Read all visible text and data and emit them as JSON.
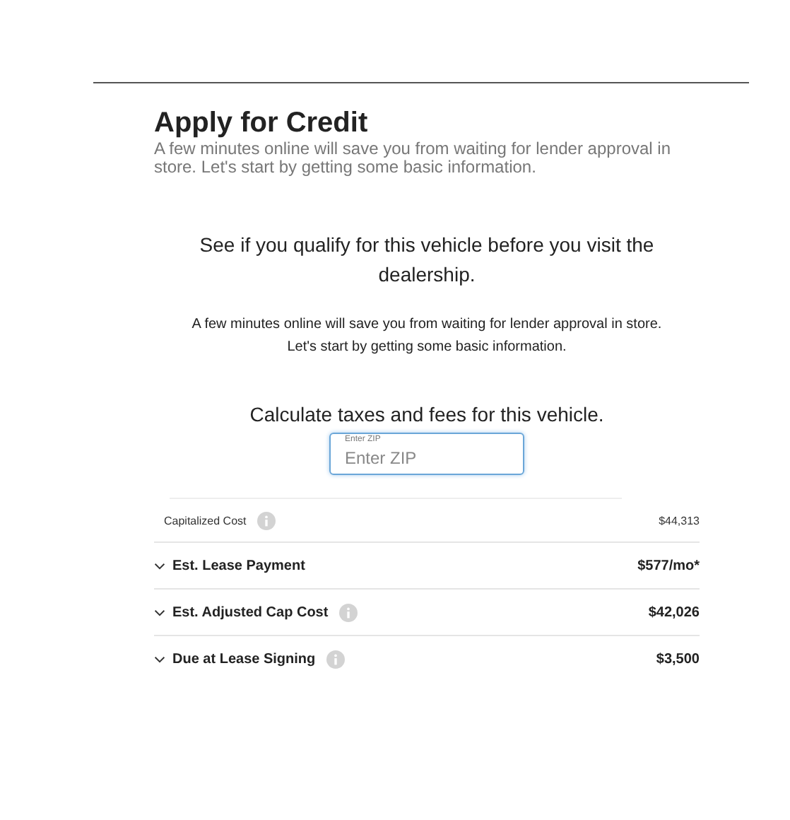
{
  "header": {
    "title": "Apply for Credit",
    "subtitle": "A few minutes online will save you from waiting for lender approval in store. Let's start by getting some basic information."
  },
  "intro": {
    "heading": "See if you qualify for this vehicle before you visit the dealership.",
    "text": [
      "A few minutes online will save you from waiting for lender approval in store.",
      "Let's start by getting some basic information."
    ]
  },
  "calculator": {
    "heading": "Calculate taxes and fees for this vehicle.",
    "zip_field": {
      "label": "Enter ZIP",
      "placeholder": "Enter ZIP",
      "focused": true
    }
  },
  "rows": [
    {
      "kind": "plain",
      "label": "Capitalized Cost",
      "info": true,
      "value": "$44,313"
    },
    {
      "kind": "expandable",
      "label": "Est. Lease Payment",
      "info": false,
      "expanded": false,
      "value": "$577/mo*"
    },
    {
      "kind": "expandable",
      "label": "Est. Adjusted Cap Cost",
      "info": true,
      "expanded": false,
      "value": "$42,026"
    },
    {
      "kind": "expandable",
      "label": "Due at Lease Signing",
      "info": true,
      "expanded": false,
      "value": "$3,500"
    }
  ]
}
